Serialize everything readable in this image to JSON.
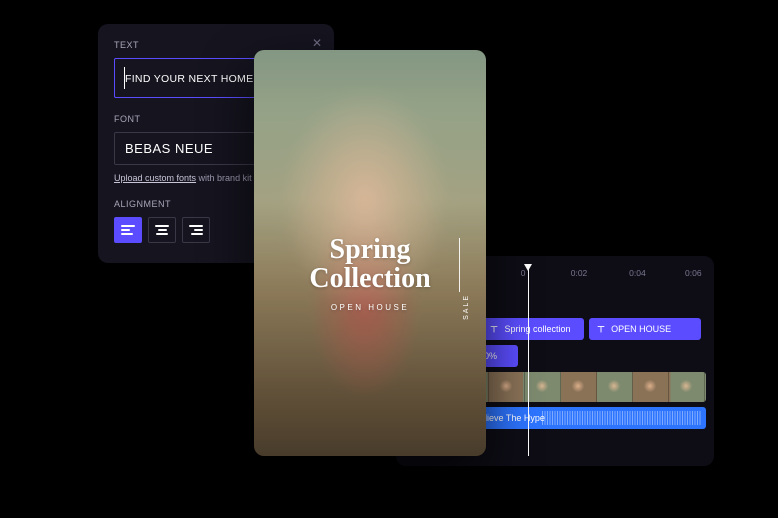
{
  "textPanel": {
    "sectionText": "TEXT",
    "textValue": "FIND YOUR NEXT HOME",
    "sectionFont": "FONT",
    "fontName": "BEBAS NEUE",
    "uploadLinkLabel": "Upload custom fonts",
    "uploadRest": " with brand kit",
    "sectionAlign": "ALIGNMENT"
  },
  "preview": {
    "line1": "Spring",
    "line2": "Collection",
    "subtitle": "OPEN HOUSE",
    "sideLabel": "SALE"
  },
  "timeline": {
    "ticks": [
      "0",
      "0:02",
      "0:04",
      "0:06"
    ],
    "clips": {
      "text1": "Spring collection",
      "text2": "OPEN HOUSE",
      "zoom": "100%",
      "audio": "Believe The Hype"
    }
  }
}
